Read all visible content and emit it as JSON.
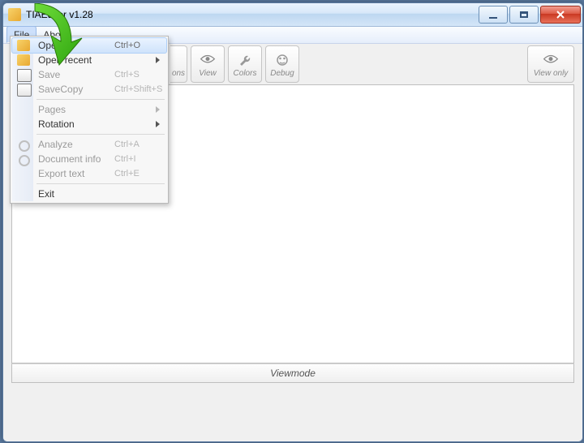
{
  "window": {
    "title": "TIAEditor v1.28"
  },
  "menubar": {
    "file": "File",
    "about": "About"
  },
  "file_menu": {
    "open": {
      "label": "Open",
      "shortcut": "Ctrl+O"
    },
    "open_recent": {
      "label": "Open recent"
    },
    "save": {
      "label": "Save",
      "shortcut": "Ctrl+S"
    },
    "save_copy": {
      "label": "SaveCopy",
      "shortcut": "Ctrl+Shift+S"
    },
    "pages": {
      "label": "Pages"
    },
    "rotation": {
      "label": "Rotation"
    },
    "analyze": {
      "label": "Analyze",
      "shortcut": "Ctrl+A"
    },
    "doc_info": {
      "label": "Document info",
      "shortcut": "Ctrl+I"
    },
    "export_text": {
      "label": "Export text",
      "shortcut": "Ctrl+E"
    },
    "exit": {
      "label": "Exit"
    }
  },
  "toolbar": {
    "partial_btn": "ons",
    "view": "View",
    "colors": "Colors",
    "debug": "Debug",
    "view_only": "View only"
  },
  "status": {
    "mode": "Viewmode"
  }
}
